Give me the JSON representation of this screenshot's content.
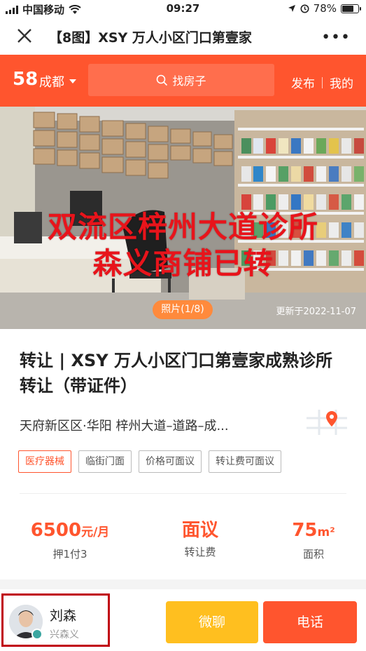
{
  "status_bar": {
    "carrier": "中国移动",
    "time": "09:27",
    "battery": "78%"
  },
  "title_bar": {
    "title": "【8图】XSY 万人小区门口第壹家",
    "more": "•••"
  },
  "header": {
    "logo": "58",
    "city": "成都",
    "search_placeholder": "找房子",
    "publish": "发布",
    "mine": "我的"
  },
  "photo": {
    "overlay_line1": "双流区梓州大道诊所",
    "overlay_line2": "森义商铺已转",
    "counter": "照片(1/8)",
    "updated": "更新于2022-11-07"
  },
  "listing": {
    "title": "转让 | XSY 万人小区门口第壹家成熟诊所转让（带证件）",
    "address": "天府新区区·华阳 梓州大道–道路–成...",
    "tags": [
      "医疗器械",
      "临街门面",
      "价格可面议",
      "转让费可面议"
    ]
  },
  "stats": {
    "rent_value": "6500",
    "rent_unit": "元/月",
    "rent_label": "押1付3",
    "fee_value": "面议",
    "fee_label": "转让费",
    "area_value": "75",
    "area_unit": "m²",
    "area_label": "面积"
  },
  "agent": {
    "name": "刘森",
    "company": "兴森义"
  },
  "actions": {
    "wechat": "微聊",
    "phone": "电话"
  },
  "colors": {
    "brand": "#ff552e",
    "wechat_button": "#ffbf1f",
    "highlight_border": "#c0000f"
  },
  "icons": [
    "signal-icon",
    "wifi-icon",
    "location-arrow-icon",
    "alarm-icon",
    "battery-icon",
    "close-icon",
    "more-icon",
    "caret-down-icon",
    "search-icon",
    "map-pin-icon",
    "verified-icon"
  ]
}
